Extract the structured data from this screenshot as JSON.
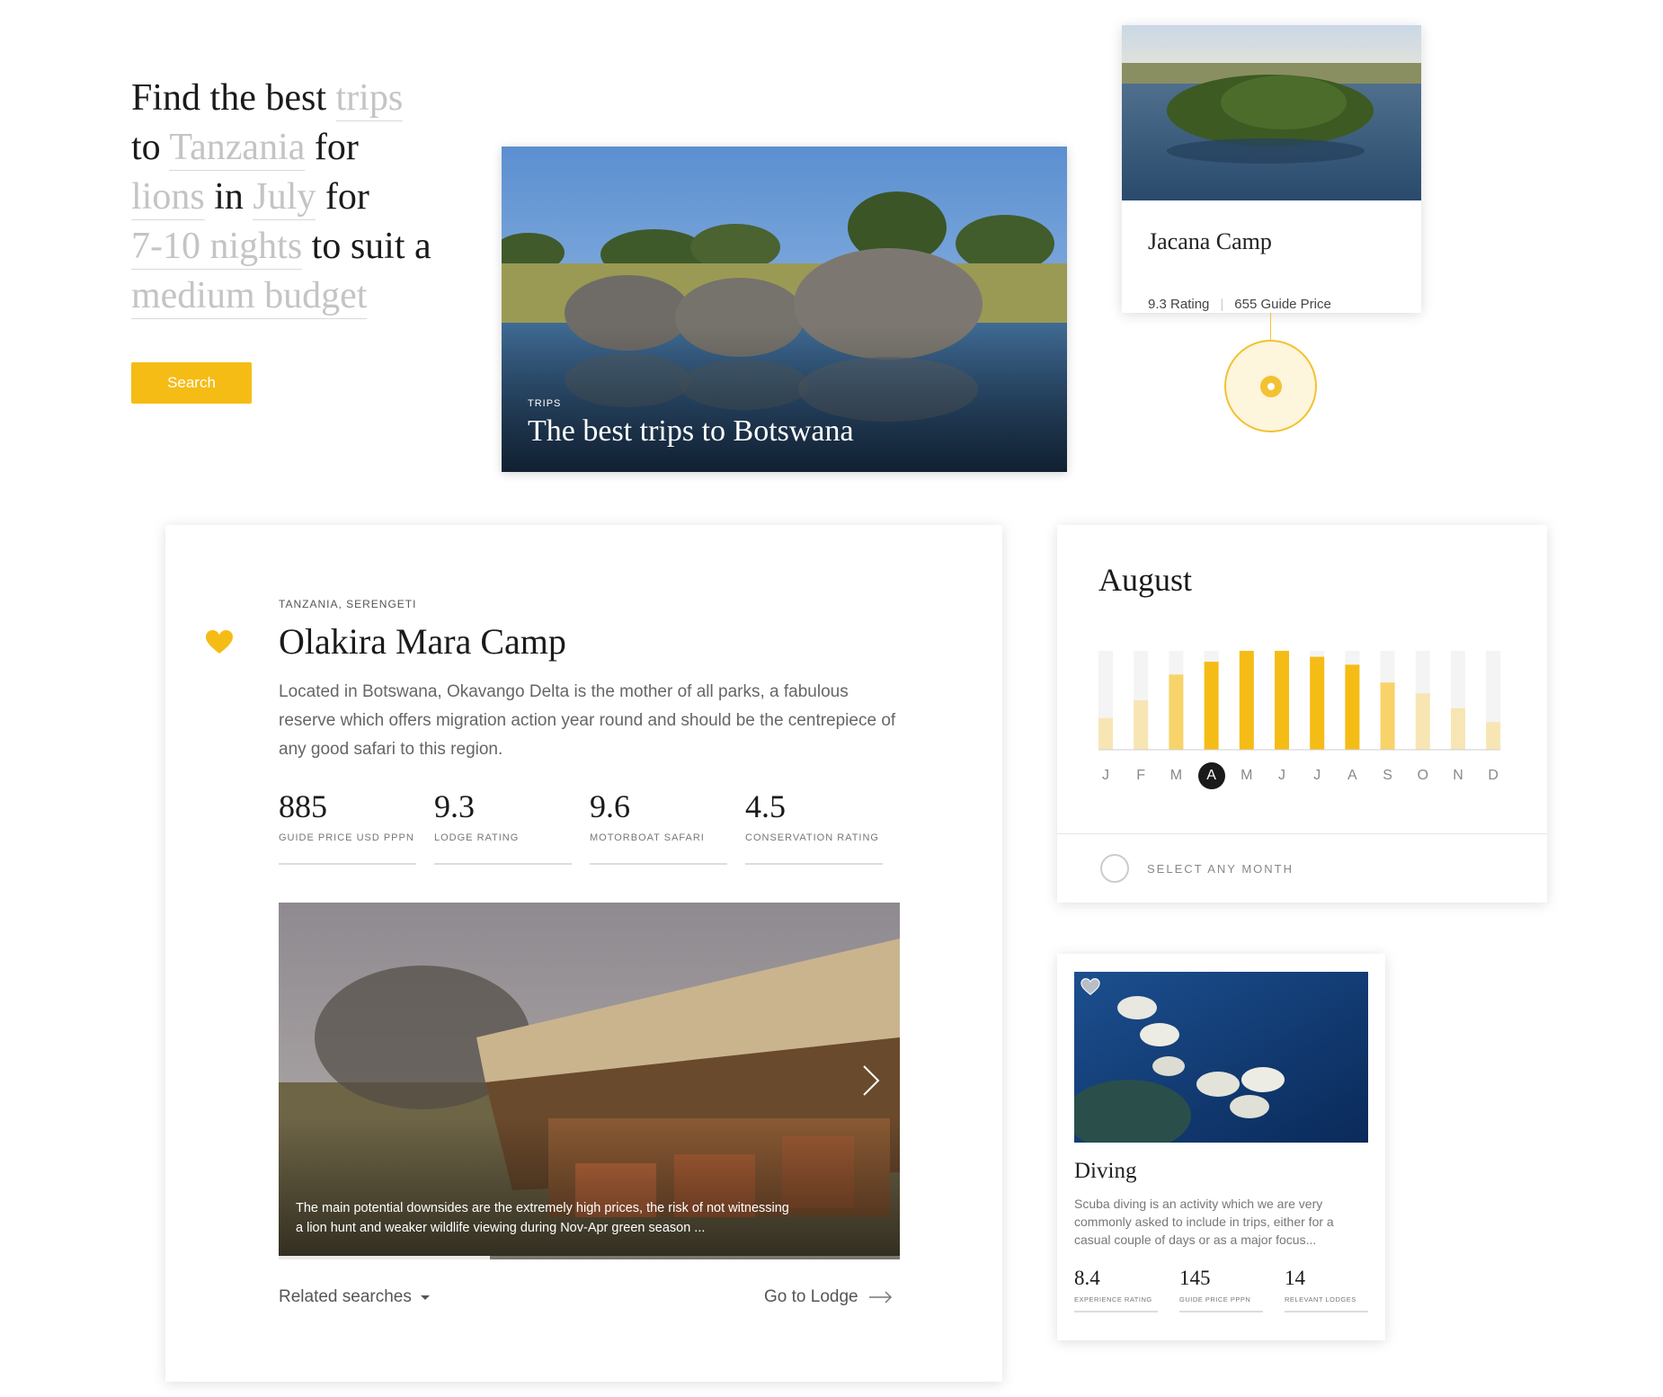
{
  "hero": {
    "line1_text": "Find the best",
    "line1_slot": "trips",
    "line2_prefix": "to",
    "line2_slot": "Tanzania",
    "line2_suffix": "for",
    "line3_slot1": "lions",
    "line3_mid": "in",
    "line3_slot2": "July",
    "line3_suffix": "for",
    "line4_slot": "7-10 nights",
    "line4_suffix": "to suit a",
    "line5_slot": "medium budget",
    "search_label": "Search"
  },
  "botswana_card": {
    "tag": "TRIPS",
    "title": "The best trips to Botswana"
  },
  "jacana_card": {
    "name": "Jacana Camp",
    "rating": "9.3 Rating",
    "sep": "|",
    "price": "655 Guide Price"
  },
  "olakira_card": {
    "location": "TANZANIA, SERENGETI",
    "name": "Olakira Mara Camp",
    "description": "Located in Botswana, Okavango Delta is the mother of all parks, a fabulous reserve which offers migration action year round and should be the centrepiece of any good safari to this region.",
    "stats": [
      {
        "value": "885",
        "label": "GUIDE PRICE USD PPPN"
      },
      {
        "value": "9.3",
        "label": "LODGE RATING"
      },
      {
        "value": "9.6",
        "label": "MOTORBOAT SAFARI"
      },
      {
        "value": "4.5",
        "label": "CONSERVATION RATING"
      }
    ],
    "gallery_caption": "The main potential downsides are the extremely high prices, the risk of not witnessing a lion hunt and weaker wildlife viewing  during Nov-Apr green season ...",
    "gallery_progress": 0.34,
    "related_label": "Related searches",
    "goto_label": "Go to Lodge"
  },
  "month_card": {
    "title": "August",
    "months": [
      "J",
      "F",
      "M",
      "A",
      "M",
      "J",
      "J",
      "A",
      "S",
      "O",
      "N",
      "D"
    ],
    "selected_index": 3,
    "any_month_label": "SELECT ANY MONTH",
    "colors": {
      "high": "#f5bc16",
      "mid": "#f7d36a",
      "low": "#f7e6b4",
      "track": "#f4f4f4"
    }
  },
  "chart_data": {
    "type": "bar",
    "categories": [
      "J",
      "F",
      "M",
      "A",
      "M",
      "J",
      "J",
      "A",
      "S",
      "O",
      "N",
      "D"
    ],
    "values": [
      0.32,
      0.5,
      0.76,
      0.89,
      1.0,
      1.0,
      0.94,
      0.86,
      0.68,
      0.57,
      0.42,
      0.28
    ],
    "ylim": [
      0,
      1
    ],
    "title": "",
    "xlabel": "",
    "ylabel": ""
  },
  "diving_card": {
    "title": "Diving",
    "description": "Scuba diving is an activity which we are very commonly asked to include in trips, either for a casual couple of days or as a major focus...",
    "stats": [
      {
        "value": "8.4",
        "label": "EXPERIENCE RATING"
      },
      {
        "value": "145",
        "label": "GUIDE PRICE PPPN"
      },
      {
        "value": "14",
        "label": "RELEVANT LODGES"
      }
    ]
  }
}
